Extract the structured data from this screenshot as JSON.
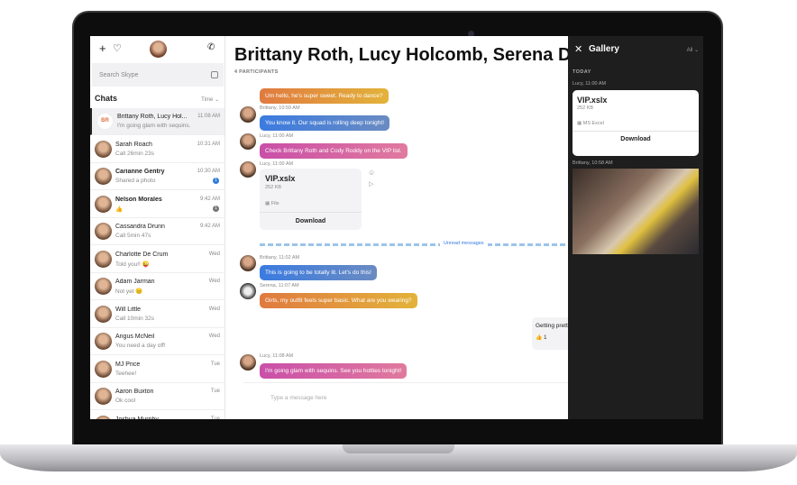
{
  "sidebar": {
    "search_placeholder": "Search Skype",
    "chats_heading": "Chats",
    "sort": "Time",
    "chats": [
      {
        "name": "Brittany Roth, Lucy Hol...",
        "initials": "BR",
        "preview": "I'm going glam with sequins.",
        "time": "11:08 AM"
      },
      {
        "name": "Sarah Roach",
        "preview": "Call 26min 23s",
        "time": "10:31 AM"
      },
      {
        "name": "Carianne Gentry",
        "preview": "Shared a photo",
        "time": "10:30 AM",
        "badge": "1"
      },
      {
        "name": "Nelson Morales",
        "preview": "👍",
        "time": "9:42 AM",
        "badge": "1"
      },
      {
        "name": "Cassandra Drunn",
        "preview": "Call 5min 47s",
        "time": "9:42 AM"
      },
      {
        "name": "Charlotte De Crum",
        "preview": "Told you!! 😜",
        "time": "Wed"
      },
      {
        "name": "Adam Jarman",
        "preview": "Not yet 😐",
        "time": "Wed"
      },
      {
        "name": "Will Little",
        "preview": "Call 10min 32s",
        "time": "Wed"
      },
      {
        "name": "Angus McNeil",
        "preview": "You need a day off!",
        "time": "Wed"
      },
      {
        "name": "MJ Price",
        "preview": "Teehee!",
        "time": "Tue"
      },
      {
        "name": "Aaron Buxton",
        "preview": "Ok cool",
        "time": "Tue"
      },
      {
        "name": "Joshua Murphy",
        "preview": "",
        "time": "Tue"
      }
    ]
  },
  "conversation": {
    "title": "Brittany Roth, Lucy Holcomb, Serena Dixon",
    "participants": "4 PARTICIPANTS",
    "messages": [
      {
        "meta": "",
        "text": "Um hello, he's super sweet. Ready to dance?"
      },
      {
        "meta": "Brittany, 10:59 AM",
        "text": "You know it. Our squad is rolling deep tonight!"
      },
      {
        "meta": "Lucy, 11:00 AM",
        "text": "Check Brittany Roth and Cody Roddy on the VIP list."
      },
      {
        "meta": "Lucy, 11:00 AM",
        "file": {
          "name": "VIP.xslx",
          "size": "252 KB",
          "type": "File",
          "action": "Download"
        }
      },
      {
        "meta": "Brittany, 11:02 AM",
        "text": "This is going to be totally lit. Let's do this!"
      },
      {
        "meta": "Serena, 11:07 AM",
        "text": "Girls, my outfit feels super basic. What are you wearing?"
      },
      {
        "meta": "Lucy, 11:08 AM",
        "text": "I'm going glam with sequins. See you hotties tonight!"
      }
    ],
    "unread_label": "Unread messages",
    "own_message": "Getting pretty",
    "own_reaction": "👍 1",
    "compose_placeholder": "Type a message here"
  },
  "gallery": {
    "title": "Gallery",
    "filter": "All",
    "section": "TODAY",
    "file": {
      "meta": "Lucy, 11:00 AM",
      "name": "VIP.xslx",
      "size": "252 KB",
      "type": "MS Excel",
      "action": "Download"
    },
    "photo_meta": "Brittany, 10:58 AM"
  }
}
